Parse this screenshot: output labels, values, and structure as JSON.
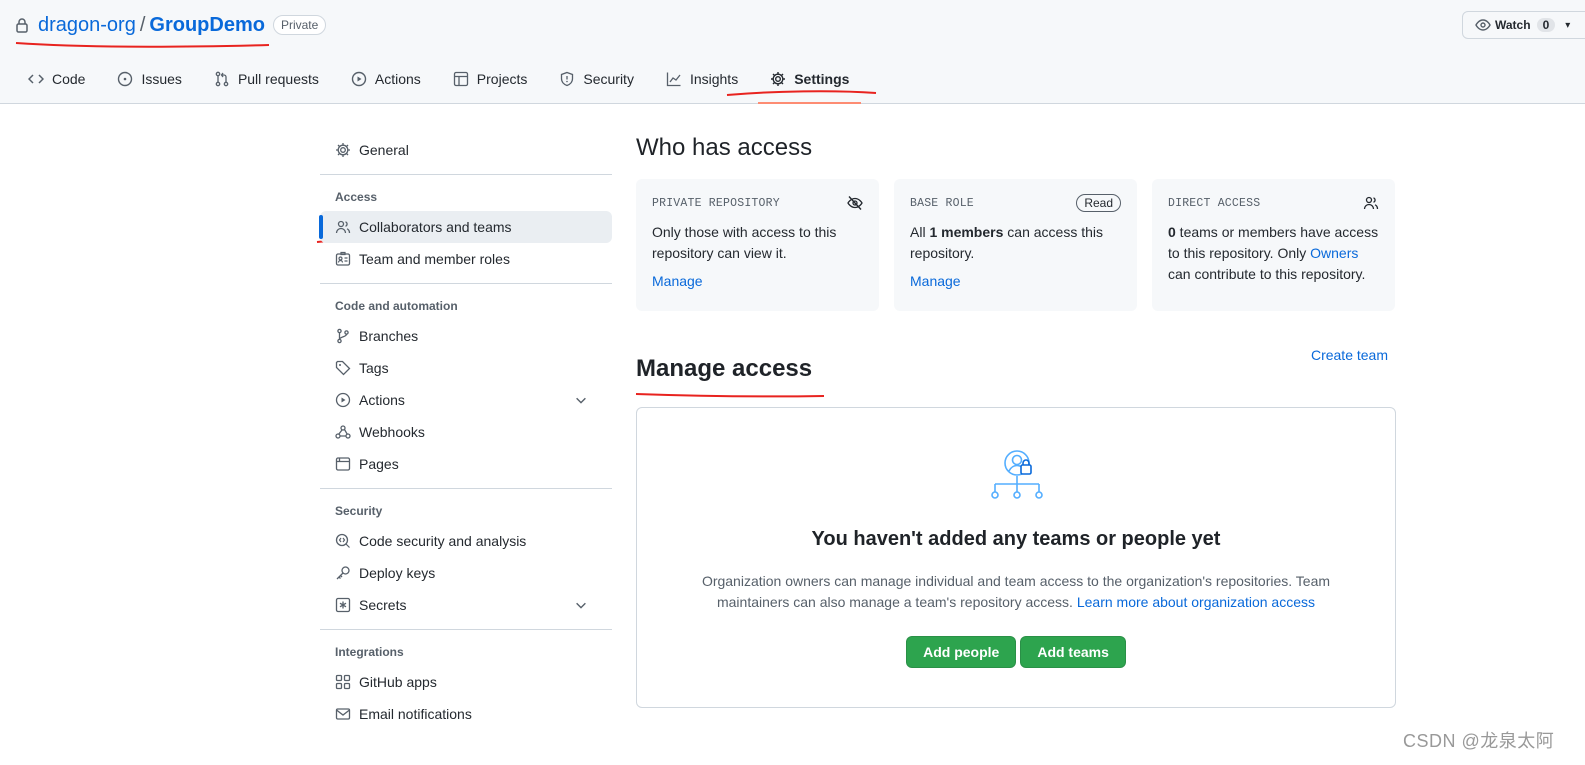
{
  "header": {
    "owner": "dragon-org",
    "separator": "/",
    "repo": "GroupDemo",
    "visibility_badge": "Private",
    "watch_label": "Watch",
    "watch_count": "0"
  },
  "tabs": [
    {
      "label": "Code",
      "icon": "code-icon"
    },
    {
      "label": "Issues",
      "icon": "issue-icon"
    },
    {
      "label": "Pull requests",
      "icon": "pull-request-icon"
    },
    {
      "label": "Actions",
      "icon": "play-icon"
    },
    {
      "label": "Projects",
      "icon": "table-icon"
    },
    {
      "label": "Security",
      "icon": "shield-icon"
    },
    {
      "label": "Insights",
      "icon": "graph-icon"
    },
    {
      "label": "Settings",
      "icon": "gear-icon",
      "selected": true
    }
  ],
  "sidebar": {
    "general": "General",
    "sections": [
      {
        "heading": "Access",
        "items": [
          "Collaborators and teams",
          "Team and member roles"
        ]
      },
      {
        "heading": "Code and automation",
        "items": [
          "Branches",
          "Tags",
          "Actions",
          "Webhooks",
          "Pages"
        ]
      },
      {
        "heading": "Security",
        "items": [
          "Code security and analysis",
          "Deploy keys",
          "Secrets"
        ]
      },
      {
        "heading": "Integrations",
        "items": [
          "GitHub apps",
          "Email notifications"
        ]
      }
    ],
    "active_item": "Collaborators and teams"
  },
  "who_has_access": {
    "title": "Who has access",
    "cards": [
      {
        "label": "PRIVATE REPOSITORY",
        "text": "Only those with access to this repository can view it.",
        "link": "Manage"
      },
      {
        "label": "BASE ROLE",
        "badge": "Read",
        "text_pre": "All ",
        "text_bold": "1 members",
        "text_post": " can access this repository.",
        "link": "Manage"
      },
      {
        "label": "DIRECT ACCESS",
        "text_bold": "0",
        "text_post": " teams or members have access to this repository. Only ",
        "text_link": "Owners",
        "text_end": " can contribute to this repository."
      }
    ]
  },
  "manage_access": {
    "title": "Manage access",
    "create_team": "Create team",
    "empty_title": "You haven't added any teams or people yet",
    "empty_desc": "Organization owners can manage individual and team access to the organization's repositories. Team maintainers can also manage a team's repository access.",
    "learn_more": "Learn more about organization access",
    "add_people": "Add people",
    "add_teams": "Add teams"
  },
  "watermark": "CSDN @龙泉太阿",
  "colors": {
    "link": "#0969da",
    "primary_button": "#2da44e",
    "selected_tab_underline": "#fd8c73",
    "annotation_red": "#e8231f"
  }
}
